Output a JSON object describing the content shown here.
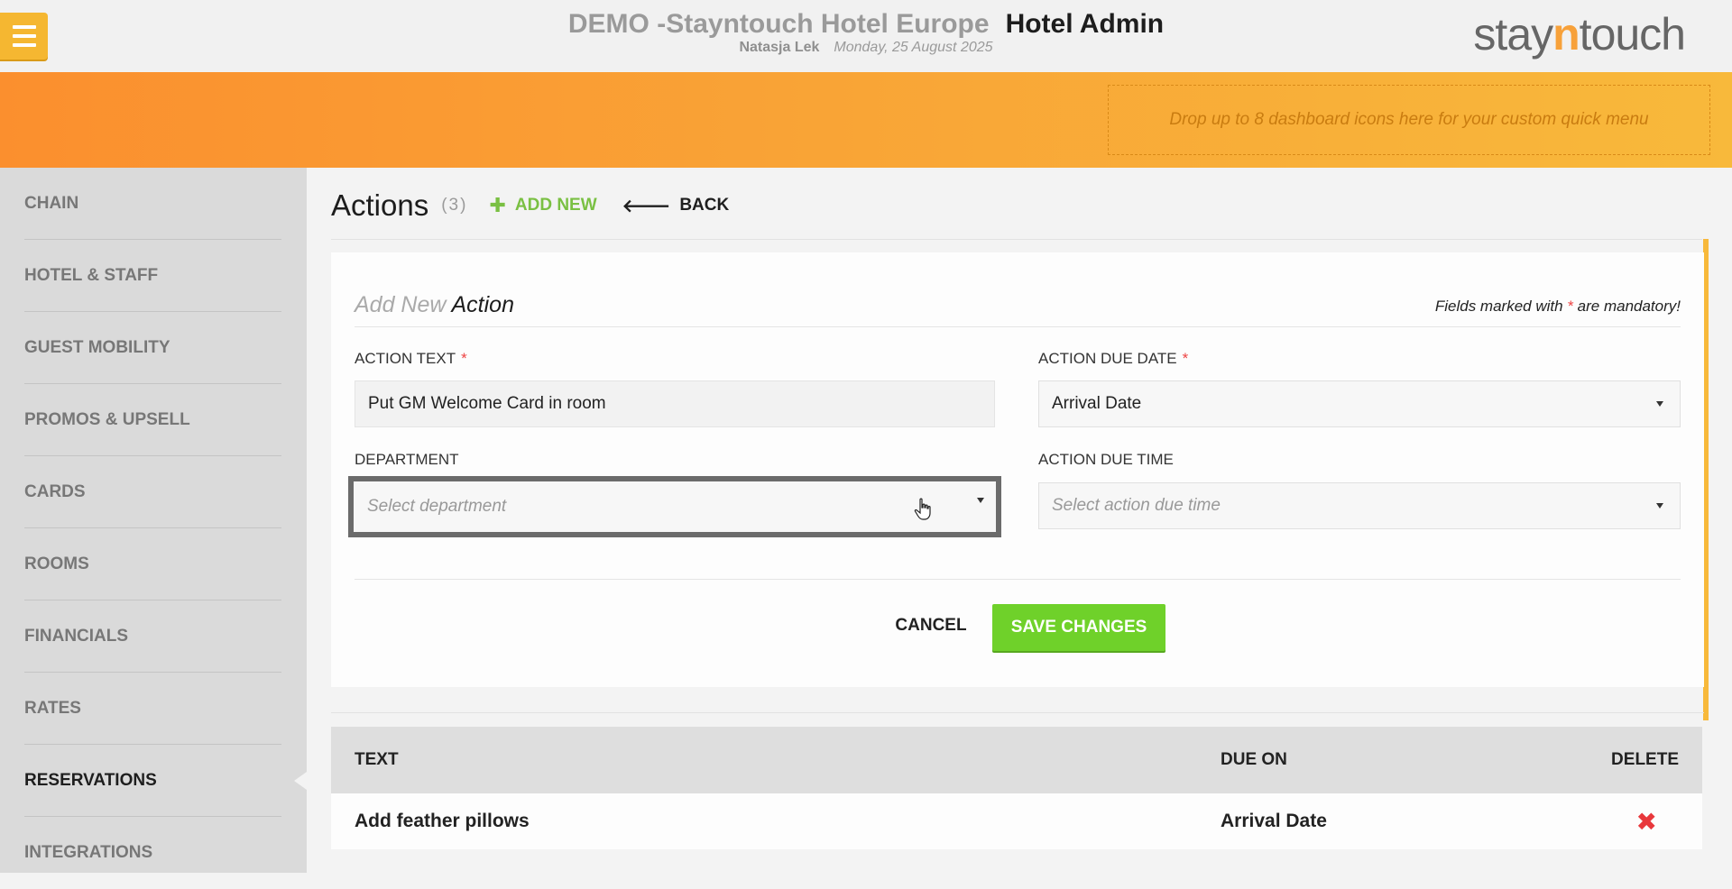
{
  "header": {
    "hotel_name": "DEMO -Stayntouch Hotel Europe",
    "section": "Hotel Admin",
    "user": "Natasja Lek",
    "date": "Monday, 25 August 2025",
    "logo_prefix": "stay",
    "logo_n": "n",
    "logo_suffix": "touch"
  },
  "quick_menu": {
    "dropzone_text": "Drop up to 8 dashboard icons here for your custom quick menu"
  },
  "sidebar": {
    "items": [
      {
        "label": "CHAIN"
      },
      {
        "label": "HOTEL & STAFF"
      },
      {
        "label": "GUEST MOBILITY"
      },
      {
        "label": "PROMOS & UPSELL"
      },
      {
        "label": "CARDS"
      },
      {
        "label": "ROOMS"
      },
      {
        "label": "FINANCIALS"
      },
      {
        "label": "RATES"
      },
      {
        "label": "RESERVATIONS"
      },
      {
        "label": "INTEGRATIONS"
      }
    ],
    "active": "RESERVATIONS"
  },
  "page": {
    "title": "Actions",
    "count": "(3)",
    "add_new_label": "ADD NEW",
    "back_label": "BACK"
  },
  "form": {
    "title_prefix": "Add New",
    "title_main": "Action",
    "mandatory_prefix": "Fields marked with",
    "mandatory_star": "*",
    "mandatory_suffix": "are mandatory!",
    "action_text_label": "ACTION TEXT",
    "action_text_value": "Put GM Welcome Card in room",
    "due_date_label": "ACTION DUE DATE",
    "due_date_value": "Arrival Date",
    "department_label": "DEPARTMENT",
    "department_placeholder": "Select department",
    "due_time_label": "ACTION DUE TIME",
    "due_time_placeholder": "Select action due time",
    "required_star": "*",
    "cancel_label": "CANCEL",
    "save_label": "SAVE CHANGES"
  },
  "table": {
    "headers": {
      "text": "TEXT",
      "due_on": "DUE ON",
      "delete": "DELETE"
    },
    "rows": [
      {
        "text": "Add feather pillows",
        "due_on": "Arrival Date"
      }
    ]
  },
  "colors": {
    "accent_orange": "#f9a336",
    "save_green": "#6fd12a",
    "add_new_green": "#7ac043",
    "delete_red": "#e8383c"
  },
  "icons": {
    "menu": "hamburger-icon",
    "add": "plus-icon",
    "back": "arrow-left-icon",
    "dropdown": "chevron-down-icon",
    "delete": "close-x-icon",
    "cursor": "hand-pointer-icon"
  }
}
